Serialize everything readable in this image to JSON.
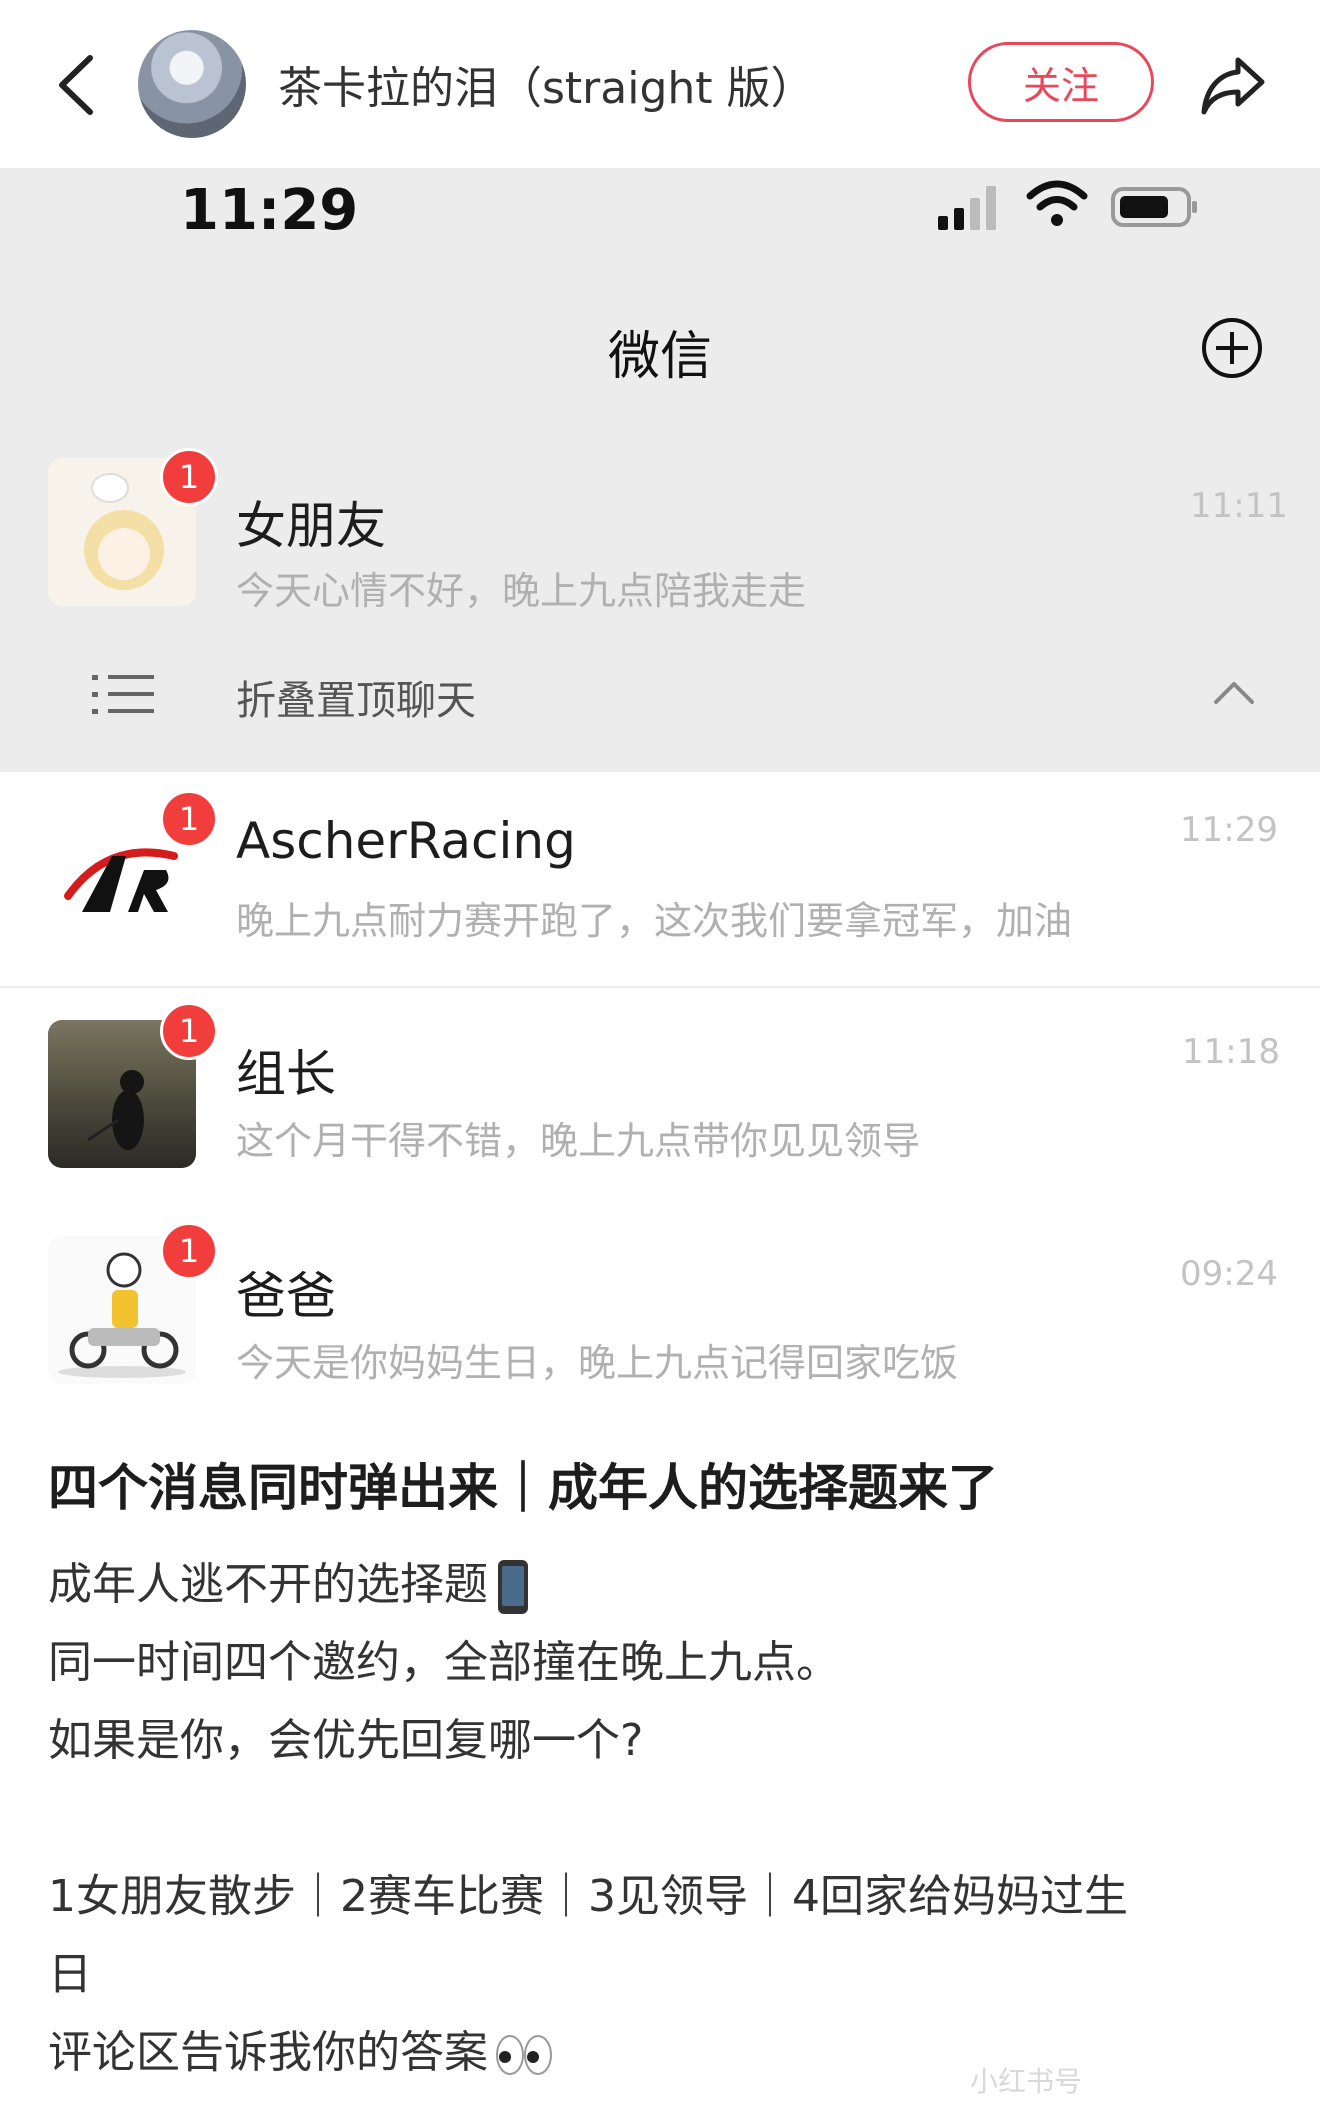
{
  "header": {
    "author_name": "茶卡拉的泪（straight 版）",
    "follow_label": "关注"
  },
  "screenshot": {
    "status_time": "11:29",
    "app_title": "微信",
    "pinned_chat": {
      "name": "女朋友",
      "message": "今天心情不好，晚上九点陪我走走",
      "time": "11:11",
      "badge": "1"
    },
    "fold_label": "折叠置顶聊天",
    "chats": [
      {
        "name": "AscherRacing",
        "message": "晚上九点耐力赛开跑了，这次我们要拿冠军，加油",
        "time": "11:29",
        "badge": "1"
      },
      {
        "name": "组长",
        "message": "这个月干得不错，晚上九点带你见见领导",
        "time": "11:18",
        "badge": "1"
      },
      {
        "name": "爸爸",
        "message": "今天是你妈妈生日，晚上九点记得回家吃饭",
        "time": "09:24",
        "badge": "1"
      }
    ]
  },
  "post": {
    "title": "四个消息同时弹出来｜成年人的选择题来了",
    "lines": [
      "成年人逃不开的选择题",
      "同一时间四个邀约，全部撞在晚上九点。",
      "如果是你，会优先回复哪一个?",
      "1女朋友散步｜2赛车比赛｜3见领导｜4回家给妈妈过生",
      "日",
      "评论区告诉我你的答案"
    ],
    "watermark": "小红书号"
  },
  "colors": {
    "accent_red": "#e9475a",
    "badge_red": "#f23d3d",
    "wechat_gray": "#ececec"
  }
}
